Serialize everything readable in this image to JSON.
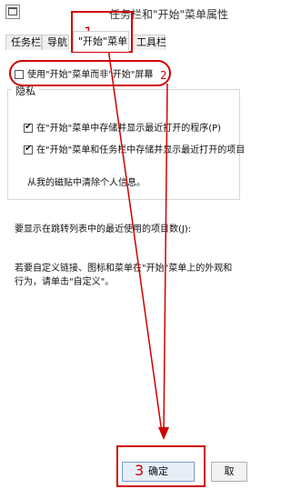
{
  "window": {
    "title": "任务栏和\"开始\"菜单属性"
  },
  "tabs": [
    {
      "label": "任务栏"
    },
    {
      "label": "导航"
    },
    {
      "label": "\"开始\"菜单"
    },
    {
      "label": "工具栏"
    }
  ],
  "options": {
    "use_start_screen": {
      "label": "使用\"开始\"菜单而非\"开始\"屏幕",
      "checked": false
    }
  },
  "privacy": {
    "title": "隐私",
    "store_recent_programs": {
      "label": "在\"开始\"菜单中存储并显示最近打开的程序(P)",
      "checked": true
    },
    "store_recent_items": {
      "label": "在\"开始\"菜单和任务栏中存储并显示最近打开的项目",
      "checked": true
    },
    "clear_text": "从我的磁贴中清除个人信息。"
  },
  "jumplist_text": "要显示在跳转列表中的最近使用的项目数(J):",
  "customize_text_line1": "若要自定义链接、图标和菜单在\"开始\"菜单上的外观和",
  "customize_text_line2": "行为，请单击\"自定义\"。",
  "buttons": {
    "ok": "确定",
    "cancel": "取"
  },
  "annotations": {
    "step1": "1",
    "step2": "2",
    "step3": "3",
    "color": "#d00000"
  }
}
